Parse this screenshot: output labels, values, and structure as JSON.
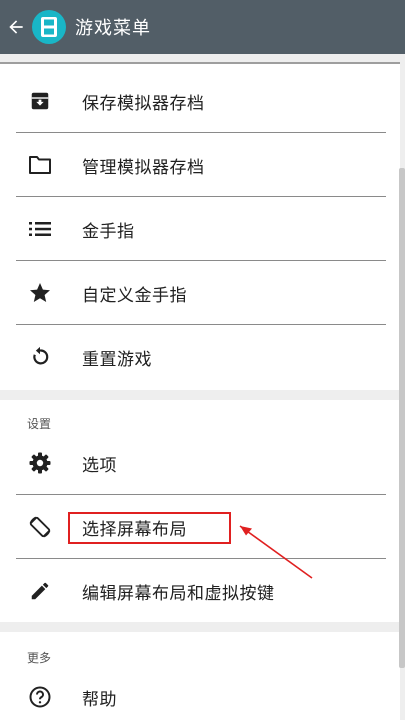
{
  "appbar": {
    "title": "游戏菜单",
    "back_icon": "arrow-left-icon",
    "app_icon": "ds-emulator-icon",
    "bg_color": "#525e67",
    "icon_color": "#19b6c7"
  },
  "menu": {
    "items": [
      {
        "label": "保存模拟器存档",
        "icon": "archive-box-icon"
      },
      {
        "label": "管理模拟器存档",
        "icon": "folder-icon"
      },
      {
        "label": "金手指",
        "icon": "list-icon"
      },
      {
        "label": "自定义金手指",
        "icon": "star-icon"
      },
      {
        "label": "重置游戏",
        "icon": "restart-icon"
      }
    ]
  },
  "settings": {
    "header": "设置",
    "items": [
      {
        "label": "选项",
        "icon": "gear-icon"
      },
      {
        "label": "选择屏幕布局",
        "icon": "screen-rotation-icon"
      },
      {
        "label": "编辑屏幕布局和虚拟按键",
        "icon": "pencil-icon"
      }
    ]
  },
  "more": {
    "header": "更多",
    "items": [
      {
        "label": "帮助",
        "icon": "help-circle-icon"
      }
    ]
  },
  "annotation": {
    "highlight_color": "#e02020"
  }
}
